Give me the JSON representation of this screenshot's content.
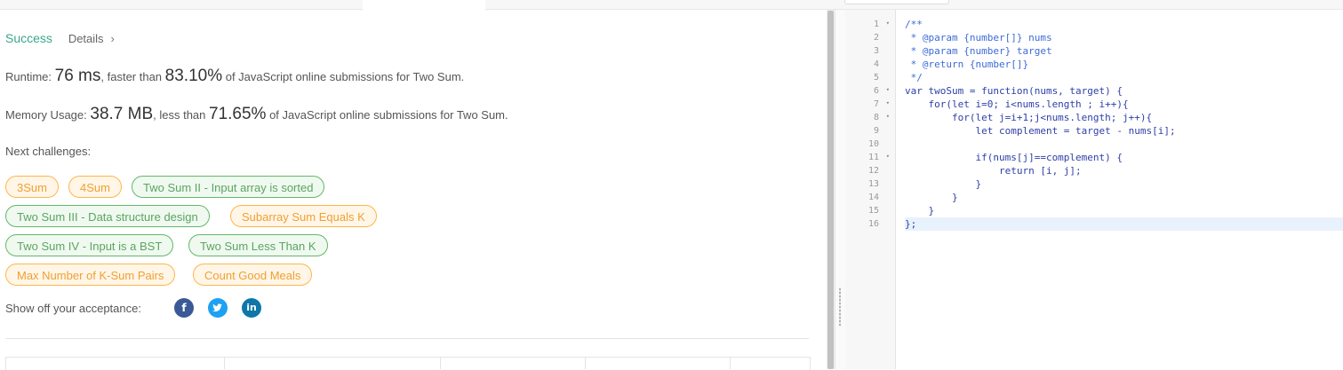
{
  "result": {
    "status": "Success",
    "details_label": "Details",
    "details_chevron": "›",
    "runtime_prefix": "Runtime: ",
    "runtime_value": "76 ms",
    "runtime_mid": ", faster than ",
    "runtime_percent": "83.10%",
    "runtime_suffix": " of JavaScript online submissions for Two Sum.",
    "memory_prefix": "Memory Usage: ",
    "memory_value": "38.7 MB",
    "memory_mid": ", less than ",
    "memory_percent": "71.65%",
    "memory_suffix": " of JavaScript online submissions for Two Sum."
  },
  "challenges": {
    "heading": "Next challenges:",
    "items": [
      {
        "label": "3Sum",
        "difficulty": "medium"
      },
      {
        "label": "4Sum",
        "difficulty": "medium"
      },
      {
        "label": "Two Sum II - Input array is sorted",
        "difficulty": "easy"
      },
      {
        "label": "Two Sum III - Data structure design",
        "difficulty": "easy"
      },
      {
        "label": "Subarray Sum Equals K",
        "difficulty": "medium"
      },
      {
        "label": "Two Sum IV - Input is a BST",
        "difficulty": "easy"
      },
      {
        "label": "Two Sum Less Than K",
        "difficulty": "easy"
      },
      {
        "label": "Max Number of K-Sum Pairs",
        "difficulty": "medium"
      },
      {
        "label": "Count Good Meals",
        "difficulty": "medium"
      }
    ]
  },
  "share": {
    "label": "Show off your acceptance:",
    "facebook_glyph": "f",
    "twitter_glyph": "🐦",
    "linkedin_glyph": "in"
  },
  "colors": {
    "success": "#3ca58b",
    "medium_chip": "#ffb54a",
    "easy_chip": "#62b86a"
  },
  "editor": {
    "lines": [
      {
        "n": "1",
        "fold": true,
        "text": "/**"
      },
      {
        "n": "2",
        "fold": false,
        "text": " * @param {number[]} nums"
      },
      {
        "n": "3",
        "fold": false,
        "text": " * @param {number} target"
      },
      {
        "n": "4",
        "fold": false,
        "text": " * @return {number[]}"
      },
      {
        "n": "5",
        "fold": false,
        "text": " */"
      },
      {
        "n": "6",
        "fold": true,
        "text": "var twoSum = function(nums, target) {"
      },
      {
        "n": "7",
        "fold": true,
        "text": "    for(let i=0; i<nums.length ; i++){"
      },
      {
        "n": "8",
        "fold": true,
        "text": "        for(let j=i+1;j<nums.length; j++){"
      },
      {
        "n": "9",
        "fold": false,
        "text": "            let complement = target - nums[i];"
      },
      {
        "n": "10",
        "fold": false,
        "text": ""
      },
      {
        "n": "11",
        "fold": true,
        "text": "            if(nums[j]==complement) {"
      },
      {
        "n": "12",
        "fold": false,
        "text": "                return [i, j];"
      },
      {
        "n": "13",
        "fold": false,
        "text": "            }"
      },
      {
        "n": "14",
        "fold": false,
        "text": "        }"
      },
      {
        "n": "15",
        "fold": false,
        "text": "    }"
      },
      {
        "n": "16",
        "fold": false,
        "text": "};"
      }
    ],
    "active_line": 16,
    "fold_glyph": "▾"
  }
}
